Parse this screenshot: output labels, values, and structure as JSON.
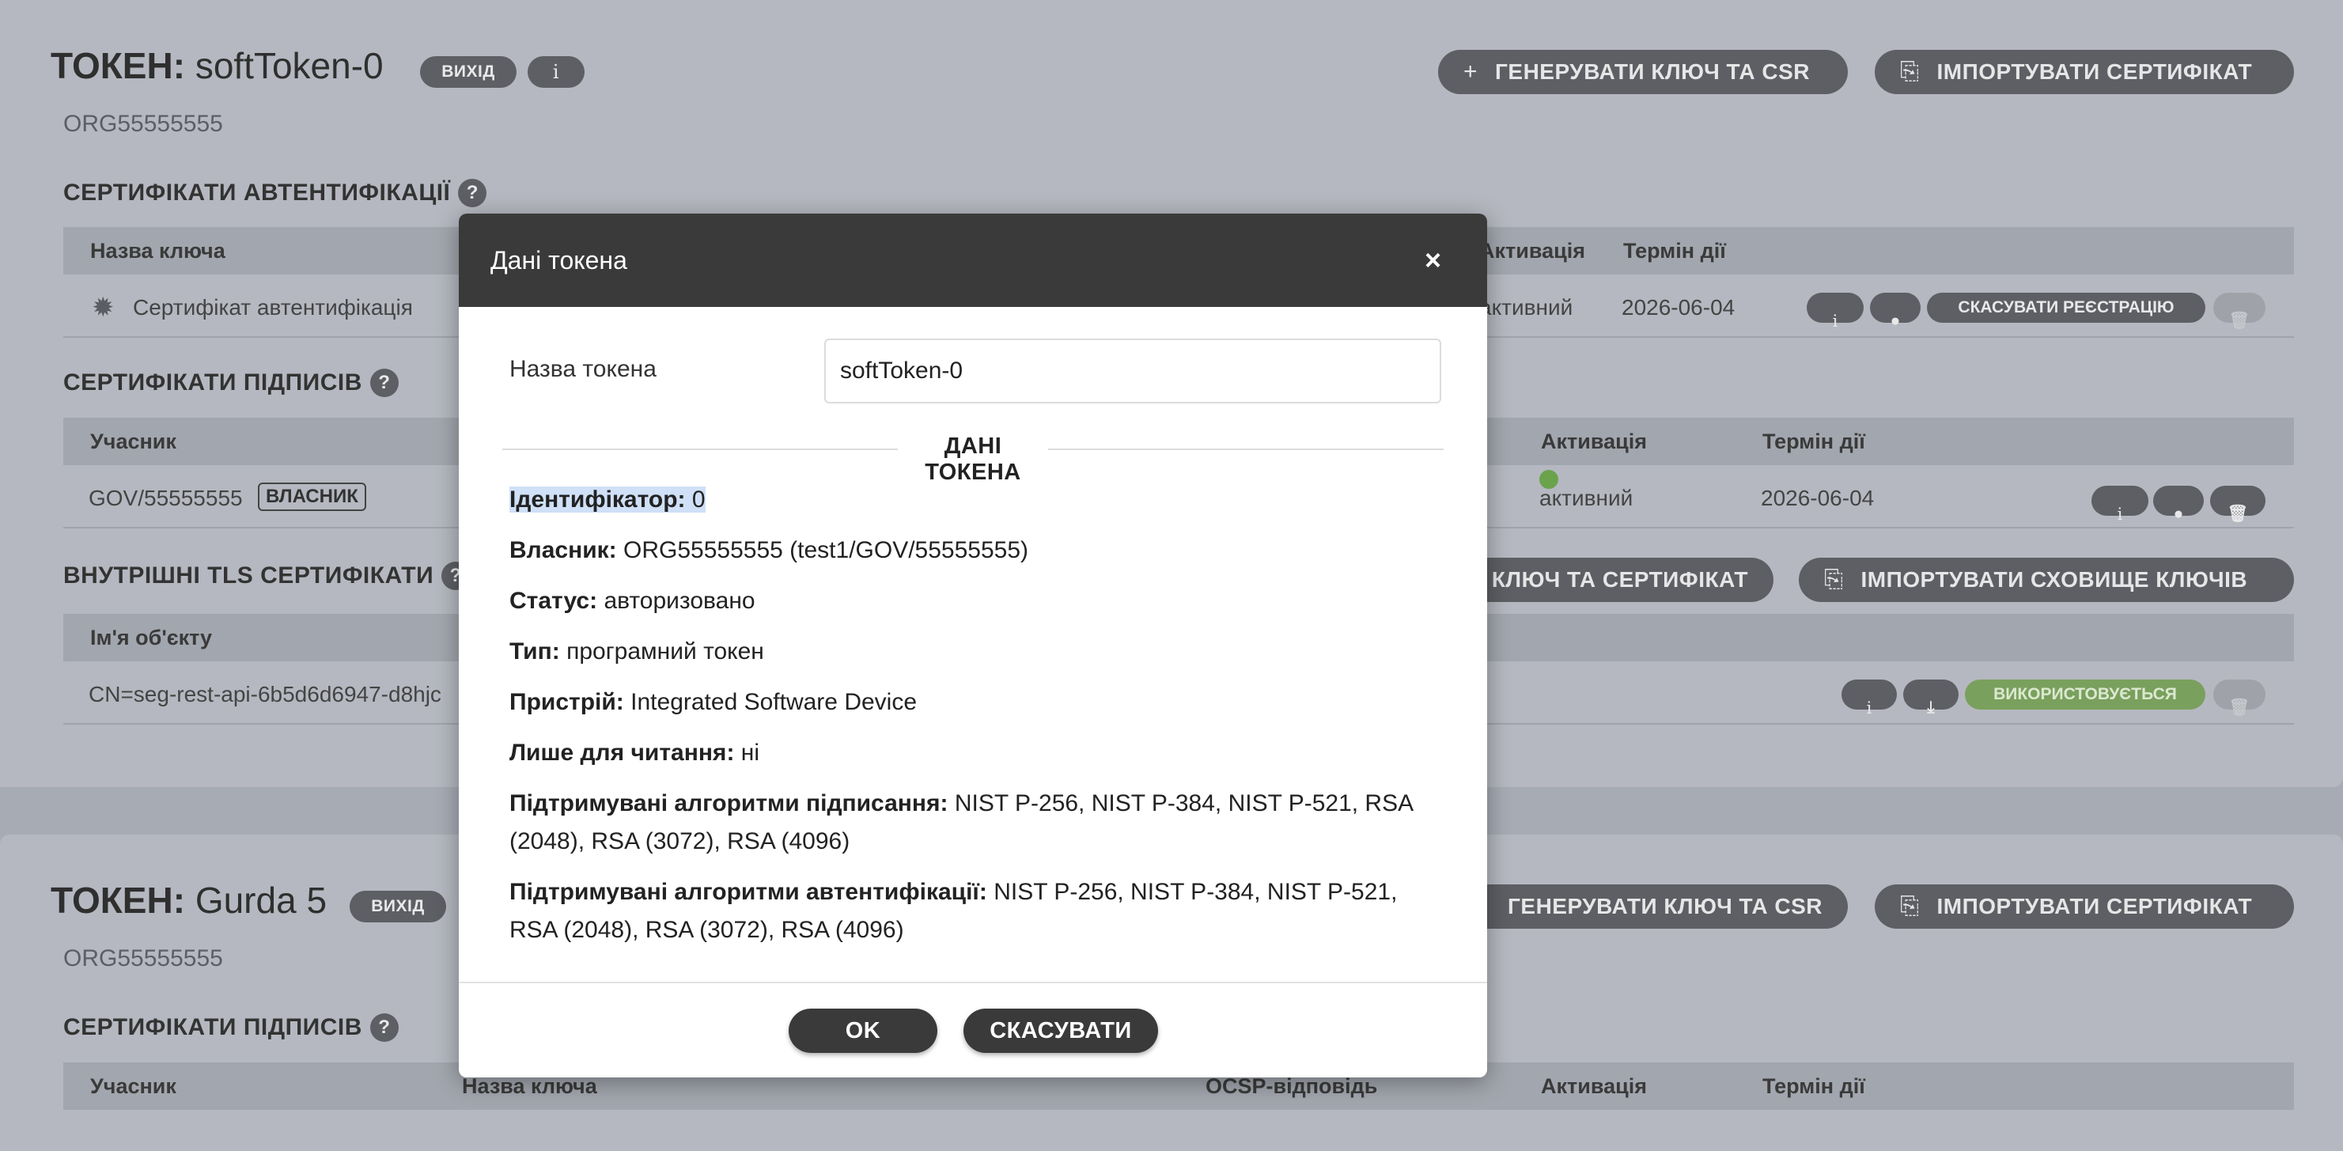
{
  "token1": {
    "title_prefix": "ТОКЕН:",
    "title_name": "softToken-0",
    "logout_label": "ВИХІД",
    "info_label": "i",
    "generate_label": "ГЕНЕРУВАТИ КЛЮЧ ТА CSR",
    "import_cert_label": "ІМПОРТУВАТИ СЕРТИФІКАТ",
    "org": "ORG55555555",
    "auth_section": {
      "title": "СЕРТИФІКАТИ АВТЕНТИФІКАЦІЇ",
      "help": "?",
      "headers": [
        "Назва ключа",
        "Активація",
        "Термін дії"
      ],
      "row": {
        "name": "Сертифікат автентифікація",
        "activation": "активний",
        "expiry": "2026-06-04",
        "unregister_label": "СКАСУВАТИ РЕЄСТРАЦІЮ"
      }
    },
    "sign_section": {
      "title": "СЕРТИФІКАТИ ПІДПИСІВ",
      "help": "?",
      "headers": [
        "Учасник",
        "Активація",
        "Термін дії"
      ],
      "row": {
        "member": "GOV/55555555",
        "owner_badge": "ВЛАСНИК",
        "activation": "активний",
        "expiry": "2026-06-04"
      }
    },
    "tls_section": {
      "title": "ВНУТРІШНІ TLS СЕРТИФІКАТИ",
      "help": "?",
      "gen_label": "КЛЮЧ ТА СЕРТИФІКАТ",
      "import_keystore_label": "ІМПОРТУВАТИ СХОВИЩЕ КЛЮЧІВ",
      "headers": [
        "Ім'я об'єкту"
      ],
      "row": {
        "subject": "CN=seg-rest-api-6b5d6d6947-d8hjc",
        "in_use_label": "ВИКОРИСТОВУЄТЬСЯ"
      }
    }
  },
  "token2": {
    "title_prefix": "ТОКЕН:",
    "title_name": "Gurda 5",
    "logout_label": "ВИХІД",
    "generate_label": "ГЕНЕРУВАТИ КЛЮЧ ТА CSR",
    "import_cert_label": "ІМПОРТУВАТИ СЕРТИФІКАТ",
    "org": "ORG55555555",
    "sign_section": {
      "title": "СЕРТИФІКАТИ ПІДПИСІВ",
      "help": "?",
      "headers": [
        "Учасник",
        "Назва ключа",
        "OCSP-відповідь",
        "Активація",
        "Термін дії"
      ]
    }
  },
  "modal": {
    "title": "Дані токена",
    "close": "×",
    "name_label": "Назва токена",
    "name_value": "softToken-0",
    "section_title": "ДАНІ ТОКЕНА",
    "rows": [
      {
        "label": "Ідентифікатор:",
        "value": "0"
      },
      {
        "label": "Власник:",
        "value": "ORG55555555 (test1/GOV/55555555)"
      },
      {
        "label": "Статус:",
        "value": "авторизовано"
      },
      {
        "label": "Тип:",
        "value": "програмний токен"
      },
      {
        "label": "Пристрій:",
        "value": "Integrated Software Device"
      },
      {
        "label": "Лише для читання:",
        "value": "ні"
      },
      {
        "label": "Підтримувані алгоритми підписання:",
        "value": "NIST P-256, NIST P-384, NIST P-521, RSA (2048), RSA (3072), RSA (4096)"
      },
      {
        "label": "Підтримувані алгоритми автентифікації:",
        "value": "NIST P-256, NIST P-384, NIST P-521, RSA (2048), RSA (3072), RSA (4096)"
      }
    ],
    "ok_label": "OK",
    "cancel_label": "СКАСУВАТИ"
  }
}
